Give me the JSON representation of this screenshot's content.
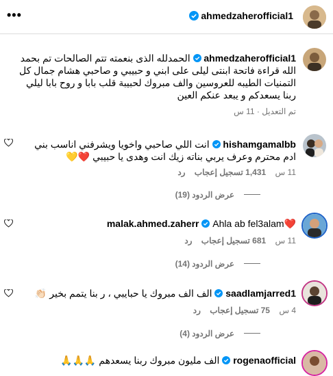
{
  "header": {
    "username": "ahmedzaherofficial1",
    "more_label": "•••"
  },
  "caption": {
    "username": "ahmedzaherofficial1",
    "lines": [
      "الحمدلله الذى بنعمته تتم الصالحات تم بحمد",
      "الله قراءة فاتحة ابنتى ليلى على ابني و حبيبي و صاحبي هشام جمال كل",
      "التمنيات الطيبه للعروسين والف مبروك لحبيبة قلب بابا و روح بابا ليلي",
      "ربنا يسعدكم و يبعد عنكم العين"
    ],
    "meta": "تم التعديل · 11 س"
  },
  "comments": [
    {
      "username": "hishamgamalbb",
      "line1": "انت اللي صاحبي واخويا ويشرفني اناسب بني",
      "line2": "ادم محترم وعرف يربي بناته زيك انت وهدى يا حبيبي ❤️💛",
      "time": "11 س",
      "likes": "1,431 تسجيل إعجاب",
      "reply": "رد",
      "replies": "عرض الردود (19)"
    },
    {
      "username": "malak.ahmed.zaherr",
      "text": "Ahla ab fel3alam❤️",
      "time": "11 س",
      "likes": "681 تسجيل إعجاب",
      "reply": "رد",
      "replies": "عرض الردود (14)"
    },
    {
      "username": "saadlamjarred1",
      "text": "الف الف مبروك يا حبايبي ، ر بنا يتمم بخير 👏🏻",
      "time": "4 س",
      "likes": "75 تسجيل إعجاب",
      "reply": "رد",
      "replies": "عرض الردود (4)"
    },
    {
      "username": "rogenaofficial",
      "text": "الف مليون مبروك ربنا يسعدهم 🙏🙏🙏"
    }
  ],
  "colors": {
    "verified": "#0095f6",
    "muted": "#737373",
    "divider": "#dbdbdb"
  }
}
